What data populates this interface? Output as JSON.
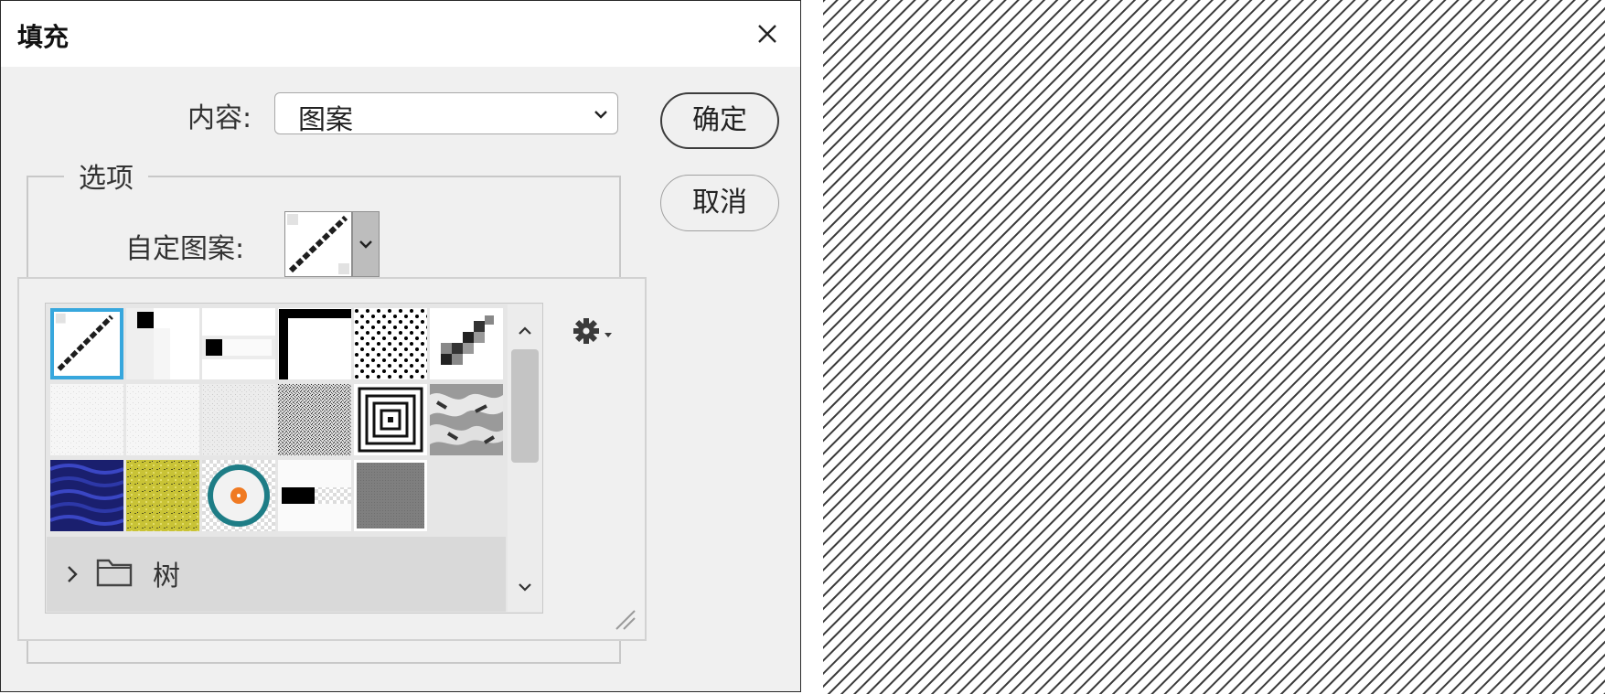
{
  "dialog": {
    "title": "填充",
    "content_label": "内容:",
    "content_value": "图案",
    "ok_label": "确定",
    "cancel_label": "取消",
    "options_legend": "选项",
    "custom_pattern_label": "自定图案:"
  },
  "picker": {
    "selected_index": 0,
    "tiles": [
      "diagonal-line-pattern",
      "vertical-bar-pattern",
      "horizontal-bar-pattern",
      "corner-pattern",
      "dots-pattern",
      "pixel-diagonal-pattern",
      "white-noise-pattern",
      "white-noise-pattern",
      "gray-noise-pattern",
      "black-noise-pattern",
      "concentric-squares-pattern",
      "gray-marble-pattern",
      "blue-waves-pattern",
      "yellow-grain-pattern",
      "orange-ring-pattern",
      "black-gradient-bar-pattern",
      "gray-fine-pattern"
    ],
    "folder_name": "树"
  },
  "colors": {
    "dialog_bg": "#f0f0f0",
    "selection_border": "#37a7dd",
    "preview_hatch": "#3a3a3a"
  }
}
